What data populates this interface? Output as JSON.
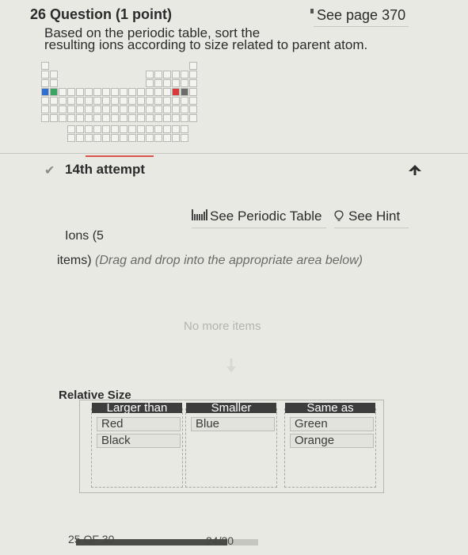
{
  "question": {
    "number": "26",
    "header_suffix": "Question (1 point)",
    "see_page": "See page 370",
    "prompt_line1": "Based on the periodic table, sort the",
    "prompt_line2": "resulting ions according to size related to parent atom."
  },
  "periodic_table": {
    "highlight_colors": {
      "blue": "#2e6fd6",
      "green": "#3aa564",
      "red": "#d63a3a",
      "gray": "#6c6c6c"
    }
  },
  "attempt": {
    "label": "14th attempt"
  },
  "tools": {
    "periodic_table_link": "See Periodic Table",
    "hint_link": "See Hint"
  },
  "ions": {
    "heading": "Ions (5",
    "items_word": "items)",
    "instruction": "(Drag and drop into the appropriate area below)",
    "empty_message": "No more items"
  },
  "sort_area": {
    "title": "Relative Size",
    "zones": [
      {
        "label": "Larger than",
        "items": [
          "Red",
          "Black"
        ]
      },
      {
        "label": "Smaller",
        "items": [
          "Blue"
        ]
      },
      {
        "label": "Same as",
        "items": [
          "Green",
          "Orange"
        ]
      }
    ]
  },
  "footer": {
    "position": "25 OF 30",
    "score": "24/30",
    "progress_fraction": 0.83
  }
}
